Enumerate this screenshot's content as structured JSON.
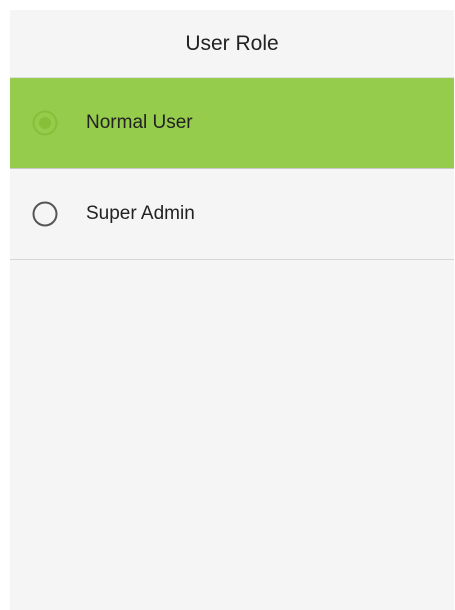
{
  "header": {
    "title": "User Role"
  },
  "options": [
    {
      "label": "Normal User",
      "selected": true
    },
    {
      "label": "Super Admin",
      "selected": false
    }
  ],
  "colors": {
    "accent": "#96cc4b",
    "background": "#f5f5f5",
    "radio_outline": "#555555",
    "radio_selected": "#8cc63f"
  },
  "icons": {
    "selected_radio": "radio-selected-icon",
    "unselected_radio": "radio-unselected-icon"
  }
}
